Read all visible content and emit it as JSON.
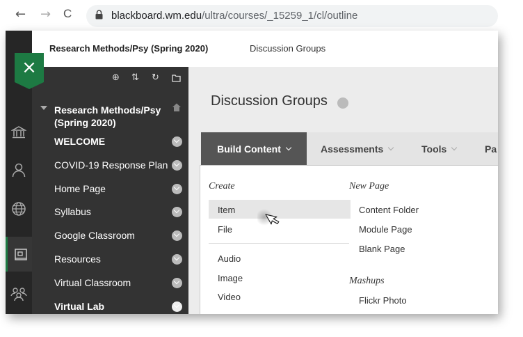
{
  "browser": {
    "back_glyph": "←",
    "forward_glyph": "→",
    "reload_glyph": "C",
    "url_host": "blackboard.wm.edu",
    "url_path": "/ultra/courses/_15259_1/cl/outline"
  },
  "breadcrumb": {
    "course": "Research Methods/Psy (Spring 2020)",
    "current": "Discussion Groups"
  },
  "close_label": "×",
  "course_menu": {
    "title": "Research Methods/Psy (Spring 2020)",
    "items": [
      {
        "label": "WELCOME"
      },
      {
        "label": "COVID-19 Response Plan"
      },
      {
        "label": "Home Page"
      },
      {
        "label": "Syllabus"
      },
      {
        "label": "Google Classroom"
      },
      {
        "label": "Resources"
      },
      {
        "label": "Virtual Classroom"
      },
      {
        "label": "Virtual Lab"
      }
    ]
  },
  "page": {
    "title": "Discussion Groups"
  },
  "action_bar": {
    "tabs": [
      {
        "label": "Build Content"
      },
      {
        "label": "Assessments"
      },
      {
        "label": "Tools"
      },
      {
        "label": "Pa"
      }
    ]
  },
  "build_menu": {
    "create_heading": "Create",
    "create_items": [
      {
        "label": "Item"
      },
      {
        "label": "File"
      },
      {
        "label": "Audio"
      },
      {
        "label": "Image"
      },
      {
        "label": "Video"
      }
    ],
    "new_page_heading": "New Page",
    "new_page_items": [
      {
        "label": "Content Folder"
      },
      {
        "label": "Module Page"
      },
      {
        "label": "Blank Page"
      }
    ],
    "mashups_heading": "Mashups",
    "mashups_items": [
      {
        "label": "Flickr Photo"
      }
    ]
  },
  "colors": {
    "accent_green": "#1d7a43",
    "menu_bg": "#333333",
    "rail_bg": "#262626",
    "active_tab": "#555555"
  }
}
